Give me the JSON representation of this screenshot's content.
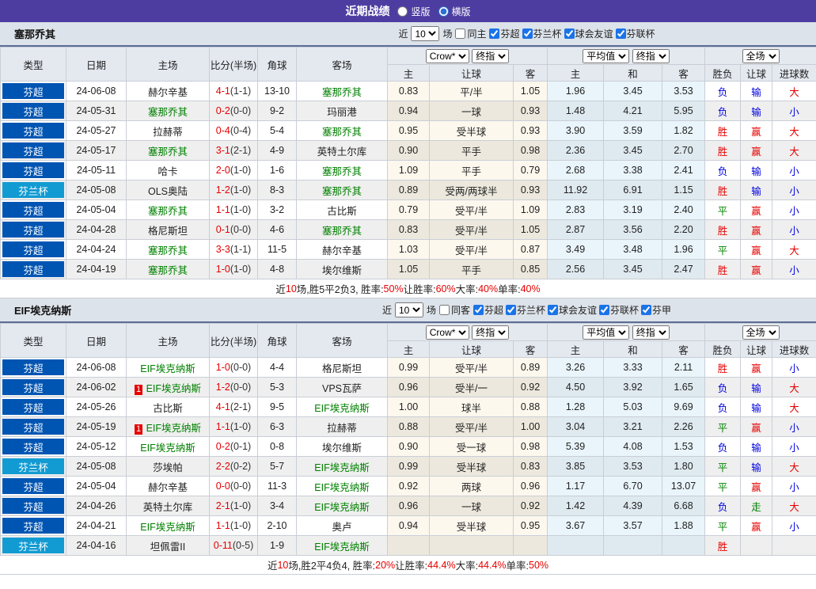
{
  "title_bar": {
    "title": "近期战绩",
    "radios": [
      {
        "label": "竖版",
        "checked": false
      },
      {
        "label": "横版",
        "checked": true
      }
    ]
  },
  "controls": {
    "crow": "Crow*",
    "final1": "终指",
    "average": "平均值",
    "final2": "终指",
    "scope": "全场"
  },
  "columns": {
    "type": "类型",
    "date": "日期",
    "home": "主场",
    "score": "比分(半场)",
    "corner": "角球",
    "away": "客场",
    "sub": [
      "主",
      "让球",
      "客",
      "主",
      "和",
      "客",
      "胜负",
      "让球",
      "进球数"
    ]
  },
  "sections": [
    {
      "team": "塞那乔其",
      "filter": {
        "recent_label": "近",
        "recent_value": "10",
        "games_label": "场",
        "same_label": "同主",
        "same_checked": false,
        "leagues": [
          {
            "label": "芬超",
            "checked": true
          },
          {
            "label": "芬兰杯",
            "checked": true
          },
          {
            "label": "球会友谊",
            "checked": true
          },
          {
            "label": "芬联杯",
            "checked": true
          }
        ]
      },
      "rows": [
        {
          "type": "芬超",
          "type_style": "super",
          "date": "24-06-08",
          "home": "赫尔辛基",
          "home_green": false,
          "home_badge": "",
          "score": "4-1",
          "half": "(1-1)",
          "corner": "13-10",
          "away": "塞那乔其",
          "away_green": true,
          "odds": [
            "0.83",
            "平/半",
            "1.05"
          ],
          "avg": [
            "1.96",
            "3.45",
            "3.53"
          ],
          "res": [
            {
              "t": "负",
              "c": "blue"
            },
            {
              "t": "输",
              "c": "blue"
            },
            {
              "t": "大",
              "c": "red"
            }
          ]
        },
        {
          "type": "芬超",
          "type_style": "super",
          "date": "24-05-31",
          "home": "塞那乔其",
          "home_green": true,
          "home_badge": "",
          "score": "0-2",
          "half": "(0-0)",
          "corner": "9-2",
          "away": "玛丽港",
          "away_green": false,
          "odds": [
            "0.94",
            "一球",
            "0.93"
          ],
          "avg": [
            "1.48",
            "4.21",
            "5.95"
          ],
          "res": [
            {
              "t": "负",
              "c": "blue"
            },
            {
              "t": "输",
              "c": "blue"
            },
            {
              "t": "小",
              "c": "blue"
            }
          ]
        },
        {
          "type": "芬超",
          "type_style": "super",
          "date": "24-05-27",
          "home": "拉赫蒂",
          "home_green": false,
          "home_badge": "",
          "score": "0-4",
          "half": "(0-4)",
          "corner": "5-4",
          "away": "塞那乔其",
          "away_green": true,
          "odds": [
            "0.95",
            "受半球",
            "0.93"
          ],
          "avg": [
            "3.90",
            "3.59",
            "1.82"
          ],
          "res": [
            {
              "t": "胜",
              "c": "red"
            },
            {
              "t": "赢",
              "c": "red"
            },
            {
              "t": "大",
              "c": "red"
            }
          ]
        },
        {
          "type": "芬超",
          "type_style": "super",
          "date": "24-05-17",
          "home": "塞那乔其",
          "home_green": true,
          "home_badge": "",
          "score": "3-1",
          "half": "(2-1)",
          "corner": "4-9",
          "away": "英特土尔库",
          "away_green": false,
          "odds": [
            "0.90",
            "平手",
            "0.98"
          ],
          "avg": [
            "2.36",
            "3.45",
            "2.70"
          ],
          "res": [
            {
              "t": "胜",
              "c": "red"
            },
            {
              "t": "赢",
              "c": "red"
            },
            {
              "t": "大",
              "c": "red"
            }
          ]
        },
        {
          "type": "芬超",
          "type_style": "super",
          "date": "24-05-11",
          "home": "哈卡",
          "home_green": false,
          "home_badge": "",
          "score": "2-0",
          "half": "(1-0)",
          "corner": "1-6",
          "away": "塞那乔其",
          "away_green": true,
          "odds": [
            "1.09",
            "平手",
            "0.79"
          ],
          "avg": [
            "2.68",
            "3.38",
            "2.41"
          ],
          "res": [
            {
              "t": "负",
              "c": "blue"
            },
            {
              "t": "输",
              "c": "blue"
            },
            {
              "t": "小",
              "c": "blue"
            }
          ]
        },
        {
          "type": "芬兰杯",
          "type_style": "cup",
          "date": "24-05-08",
          "home": "OLS奥陆",
          "home_green": false,
          "home_badge": "",
          "score": "1-2",
          "half": "(1-0)",
          "corner": "8-3",
          "away": "塞那乔其",
          "away_green": true,
          "odds": [
            "0.89",
            "受两/两球半",
            "0.93"
          ],
          "avg": [
            "11.92",
            "6.91",
            "1.15"
          ],
          "res": [
            {
              "t": "胜",
              "c": "red"
            },
            {
              "t": "输",
              "c": "blue"
            },
            {
              "t": "小",
              "c": "blue"
            }
          ]
        },
        {
          "type": "芬超",
          "type_style": "super",
          "date": "24-05-04",
          "home": "塞那乔其",
          "home_green": true,
          "home_badge": "",
          "score": "1-1",
          "half": "(1-0)",
          "corner": "3-2",
          "away": "古比斯",
          "away_green": false,
          "odds": [
            "0.79",
            "受平/半",
            "1.09"
          ],
          "avg": [
            "2.83",
            "3.19",
            "2.40"
          ],
          "res": [
            {
              "t": "平",
              "c": "green"
            },
            {
              "t": "赢",
              "c": "red"
            },
            {
              "t": "小",
              "c": "blue"
            }
          ]
        },
        {
          "type": "芬超",
          "type_style": "super",
          "date": "24-04-28",
          "home": "格尼斯坦",
          "home_green": false,
          "home_badge": "",
          "score": "0-1",
          "half": "(0-0)",
          "corner": "4-6",
          "away": "塞那乔其",
          "away_green": true,
          "odds": [
            "0.83",
            "受平/半",
            "1.05"
          ],
          "avg": [
            "2.87",
            "3.56",
            "2.20"
          ],
          "res": [
            {
              "t": "胜",
              "c": "red"
            },
            {
              "t": "赢",
              "c": "red"
            },
            {
              "t": "小",
              "c": "blue"
            }
          ]
        },
        {
          "type": "芬超",
          "type_style": "super",
          "date": "24-04-24",
          "home": "塞那乔其",
          "home_green": true,
          "home_badge": "",
          "score": "3-3",
          "half": "(1-1)",
          "corner": "11-5",
          "away": "赫尔辛基",
          "away_green": false,
          "odds": [
            "1.03",
            "受平/半",
            "0.87"
          ],
          "avg": [
            "3.49",
            "3.48",
            "1.96"
          ],
          "res": [
            {
              "t": "平",
              "c": "green"
            },
            {
              "t": "赢",
              "c": "red"
            },
            {
              "t": "大",
              "c": "red"
            }
          ]
        },
        {
          "type": "芬超",
          "type_style": "super",
          "date": "24-04-19",
          "home": "塞那乔其",
          "home_green": true,
          "home_badge": "",
          "score": "1-0",
          "half": "(1-0)",
          "corner": "4-8",
          "away": "埃尔维斯",
          "away_green": false,
          "odds": [
            "1.05",
            "平手",
            "0.85"
          ],
          "avg": [
            "2.56",
            "3.45",
            "2.47"
          ],
          "res": [
            {
              "t": "胜",
              "c": "red"
            },
            {
              "t": "赢",
              "c": "red"
            },
            {
              "t": "小",
              "c": "blue"
            }
          ]
        }
      ],
      "summary": [
        {
          "t": "近",
          "c": "black"
        },
        {
          "t": "10",
          "c": "red"
        },
        {
          "t": "场,胜5平2负3, 胜率:",
          "c": "black"
        },
        {
          "t": "50%",
          "c": "red"
        },
        {
          "t": " 让胜率:",
          "c": "black"
        },
        {
          "t": "60%",
          "c": "red"
        },
        {
          "t": " 大率:",
          "c": "black"
        },
        {
          "t": "40%",
          "c": "red"
        },
        {
          "t": " 单率:",
          "c": "black"
        },
        {
          "t": "40%",
          "c": "red"
        }
      ]
    },
    {
      "team": "EIF埃克纳斯",
      "filter": {
        "recent_label": "近",
        "recent_value": "10",
        "games_label": "场",
        "same_label": "同客",
        "same_checked": false,
        "leagues": [
          {
            "label": "芬超",
            "checked": true
          },
          {
            "label": "芬兰杯",
            "checked": true
          },
          {
            "label": "球会友谊",
            "checked": true
          },
          {
            "label": "芬联杯",
            "checked": true
          },
          {
            "label": "芬甲",
            "checked": true
          }
        ]
      },
      "rows": [
        {
          "type": "芬超",
          "type_style": "super",
          "date": "24-06-08",
          "home": "EIF埃克纳斯",
          "home_green": true,
          "home_badge": "",
          "score": "1-0",
          "half": "(0-0)",
          "corner": "4-4",
          "away": "格尼斯坦",
          "away_green": false,
          "odds": [
            "0.99",
            "受平/半",
            "0.89"
          ],
          "avg": [
            "3.26",
            "3.33",
            "2.11"
          ],
          "res": [
            {
              "t": "胜",
              "c": "red"
            },
            {
              "t": "赢",
              "c": "red"
            },
            {
              "t": "小",
              "c": "blue"
            }
          ]
        },
        {
          "type": "芬超",
          "type_style": "super",
          "date": "24-06-02",
          "home": "EIF埃克纳斯",
          "home_green": true,
          "home_badge": "1",
          "score": "1-2",
          "half": "(0-0)",
          "corner": "5-3",
          "away": "VPS瓦萨",
          "away_green": false,
          "odds": [
            "0.96",
            "受半/一",
            "0.92"
          ],
          "avg": [
            "4.50",
            "3.92",
            "1.65"
          ],
          "res": [
            {
              "t": "负",
              "c": "blue"
            },
            {
              "t": "输",
              "c": "blue"
            },
            {
              "t": "大",
              "c": "red"
            }
          ]
        },
        {
          "type": "芬超",
          "type_style": "super",
          "date": "24-05-26",
          "home": "古比斯",
          "home_green": false,
          "home_badge": "",
          "score": "4-1",
          "half": "(2-1)",
          "corner": "9-5",
          "away": "EIF埃克纳斯",
          "away_green": true,
          "odds": [
            "1.00",
            "球半",
            "0.88"
          ],
          "avg": [
            "1.28",
            "5.03",
            "9.69"
          ],
          "res": [
            {
              "t": "负",
              "c": "blue"
            },
            {
              "t": "输",
              "c": "blue"
            },
            {
              "t": "大",
              "c": "red"
            }
          ]
        },
        {
          "type": "芬超",
          "type_style": "super",
          "date": "24-05-19",
          "home": "EIF埃克纳斯",
          "home_green": true,
          "home_badge": "1",
          "score": "1-1",
          "half": "(1-0)",
          "corner": "6-3",
          "away": "拉赫蒂",
          "away_green": false,
          "odds": [
            "0.88",
            "受平/半",
            "1.00"
          ],
          "avg": [
            "3.04",
            "3.21",
            "2.26"
          ],
          "res": [
            {
              "t": "平",
              "c": "green"
            },
            {
              "t": "赢",
              "c": "red"
            },
            {
              "t": "小",
              "c": "blue"
            }
          ]
        },
        {
          "type": "芬超",
          "type_style": "super",
          "date": "24-05-12",
          "home": "EIF埃克纳斯",
          "home_green": true,
          "home_badge": "",
          "score": "0-2",
          "half": "(0-1)",
          "corner": "0-8",
          "away": "埃尔维斯",
          "away_green": false,
          "odds": [
            "0.90",
            "受一球",
            "0.98"
          ],
          "avg": [
            "5.39",
            "4.08",
            "1.53"
          ],
          "res": [
            {
              "t": "负",
              "c": "blue"
            },
            {
              "t": "输",
              "c": "blue"
            },
            {
              "t": "小",
              "c": "blue"
            }
          ]
        },
        {
          "type": "芬兰杯",
          "type_style": "cup",
          "date": "24-05-08",
          "home": "莎埃帕",
          "home_green": false,
          "home_badge": "",
          "score": "2-2",
          "half": "(0-2)",
          "corner": "5-7",
          "away": "EIF埃克纳斯",
          "away_green": true,
          "odds": [
            "0.99",
            "受半球",
            "0.83"
          ],
          "avg": [
            "3.85",
            "3.53",
            "1.80"
          ],
          "res": [
            {
              "t": "平",
              "c": "green"
            },
            {
              "t": "输",
              "c": "blue"
            },
            {
              "t": "大",
              "c": "red"
            }
          ]
        },
        {
          "type": "芬超",
          "type_style": "super",
          "date": "24-05-04",
          "home": "赫尔辛基",
          "home_green": false,
          "home_badge": "",
          "score": "0-0",
          "half": "(0-0)",
          "corner": "11-3",
          "away": "EIF埃克纳斯",
          "away_green": true,
          "odds": [
            "0.92",
            "两球",
            "0.96"
          ],
          "avg": [
            "1.17",
            "6.70",
            "13.07"
          ],
          "res": [
            {
              "t": "平",
              "c": "green"
            },
            {
              "t": "赢",
              "c": "red"
            },
            {
              "t": "小",
              "c": "blue"
            }
          ]
        },
        {
          "type": "芬超",
          "type_style": "super",
          "date": "24-04-26",
          "home": "英特土尔库",
          "home_green": false,
          "home_badge": "",
          "score": "2-1",
          "half": "(1-0)",
          "corner": "3-4",
          "away": "EIF埃克纳斯",
          "away_green": true,
          "odds": [
            "0.96",
            "一球",
            "0.92"
          ],
          "avg": [
            "1.42",
            "4.39",
            "6.68"
          ],
          "res": [
            {
              "t": "负",
              "c": "blue"
            },
            {
              "t": "走",
              "c": "green"
            },
            {
              "t": "大",
              "c": "red"
            }
          ]
        },
        {
          "type": "芬超",
          "type_style": "super",
          "date": "24-04-21",
          "home": "EIF埃克纳斯",
          "home_green": true,
          "home_badge": "",
          "score": "1-1",
          "half": "(1-0)",
          "corner": "2-10",
          "away": "奥卢",
          "away_green": false,
          "odds": [
            "0.94",
            "受半球",
            "0.95"
          ],
          "avg": [
            "3.67",
            "3.57",
            "1.88"
          ],
          "res": [
            {
              "t": "平",
              "c": "green"
            },
            {
              "t": "赢",
              "c": "red"
            },
            {
              "t": "小",
              "c": "blue"
            }
          ]
        },
        {
          "type": "芬兰杯",
          "type_style": "cup",
          "date": "24-04-16",
          "home": "坦佩雷II",
          "home_green": false,
          "home_badge": "",
          "score": "0-11",
          "half": "(0-5)",
          "corner": "1-9",
          "away": "EIF埃克纳斯",
          "away_green": true,
          "odds": [
            "",
            "",
            ""
          ],
          "avg": [
            "",
            "",
            ""
          ],
          "res": [
            {
              "t": "胜",
              "c": "red"
            },
            {
              "t": "",
              "c": "black"
            },
            {
              "t": "",
              "c": "black"
            }
          ]
        }
      ],
      "summary": [
        {
          "t": "近",
          "c": "black"
        },
        {
          "t": "10",
          "c": "red"
        },
        {
          "t": "场,胜2平4负4, 胜率:",
          "c": "black"
        },
        {
          "t": "20%",
          "c": "red"
        },
        {
          "t": " 让胜率:",
          "c": "black"
        },
        {
          "t": "44.4%",
          "c": "red"
        },
        {
          "t": " 大率:",
          "c": "black"
        },
        {
          "t": "44.4%",
          "c": "red"
        },
        {
          "t": " 单率:",
          "c": "black"
        },
        {
          "t": "50%",
          "c": "red"
        }
      ]
    }
  ],
  "colors": {
    "header_purple": "#4d3da1",
    "league_super": "#0055b3",
    "league_cup": "#129bd2",
    "team_green": "#008000",
    "win_red": "#e60000",
    "lose_blue": "#0000e0",
    "draw_green": "#008000"
  }
}
